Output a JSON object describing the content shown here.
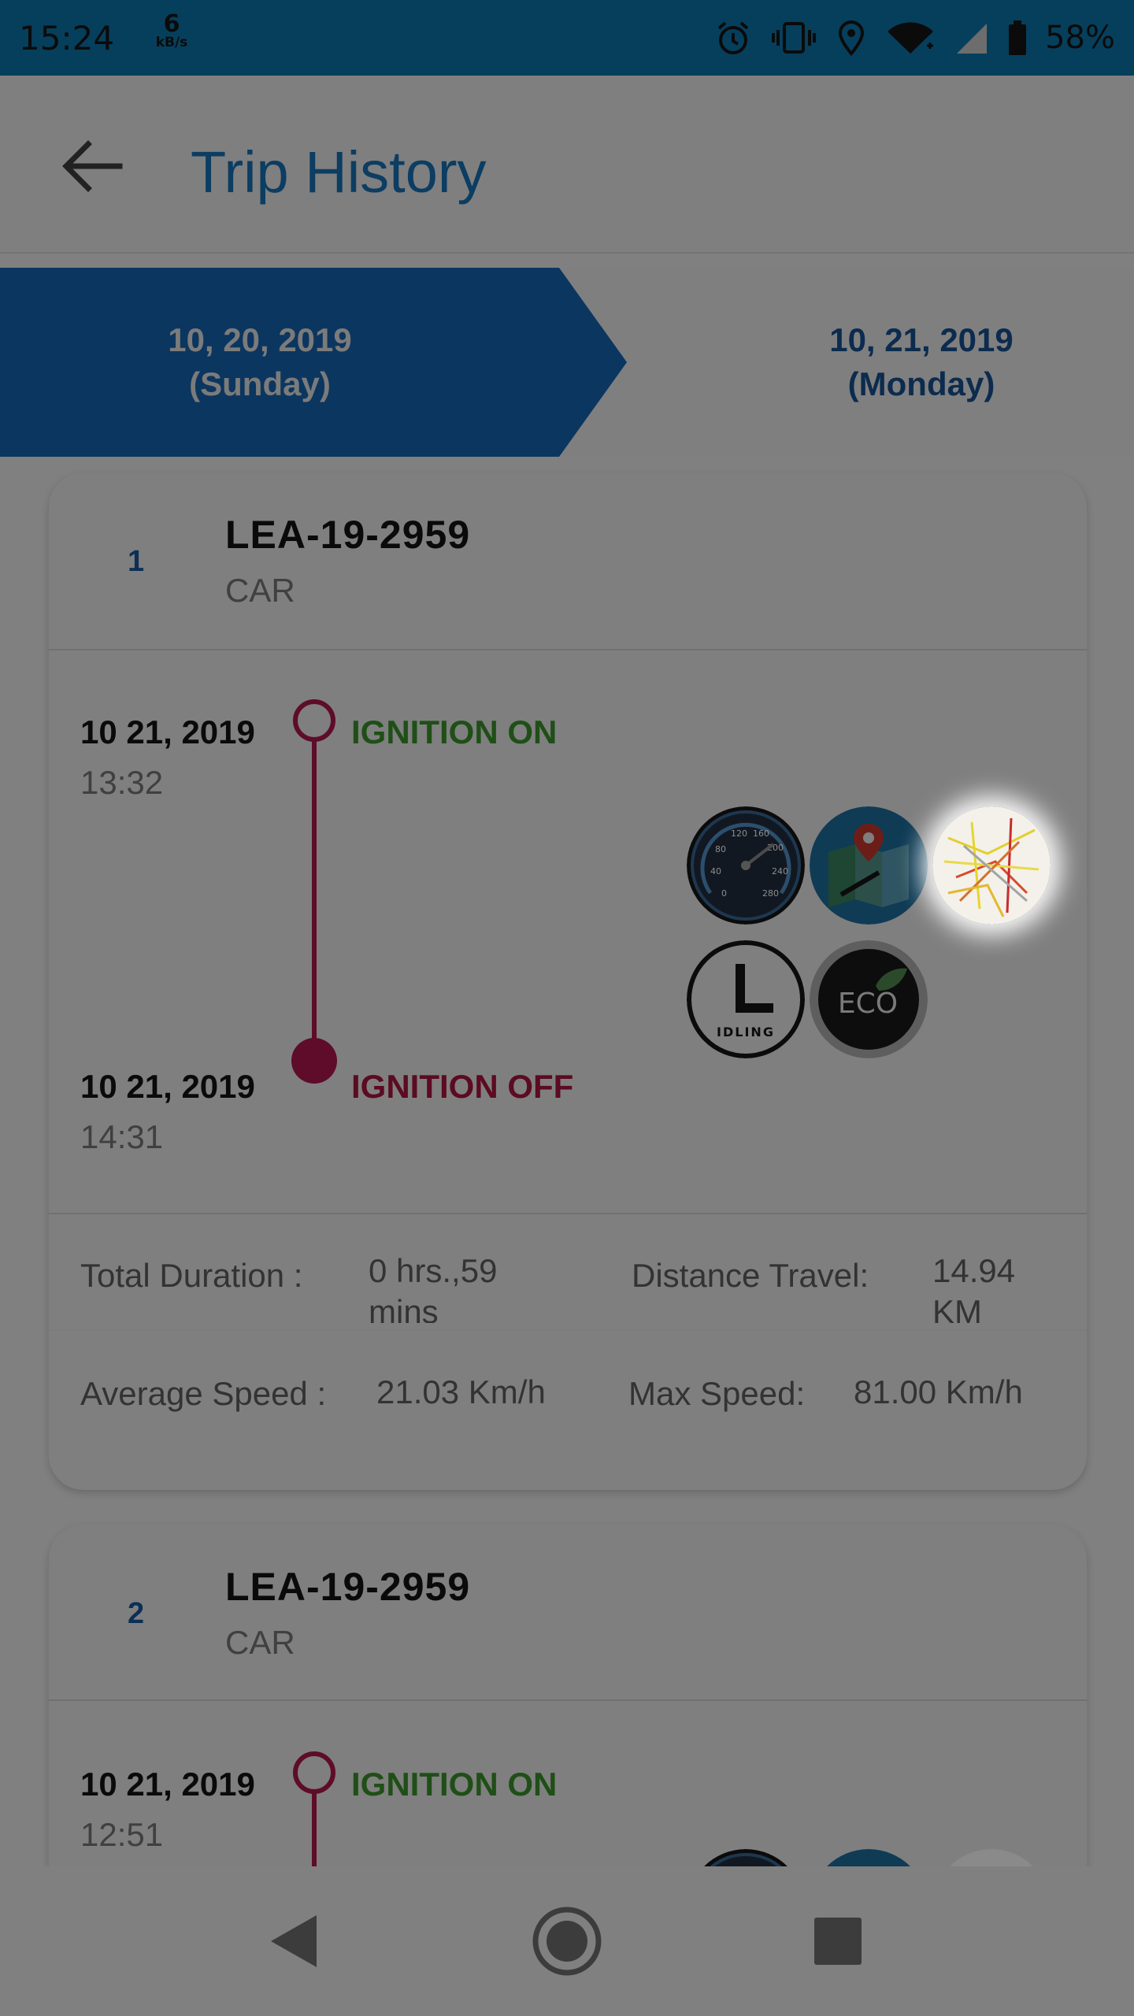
{
  "status_bar": {
    "time": "15:24",
    "net_speed": "6",
    "net_unit": "kB/s",
    "battery": "58%",
    "icons": [
      "alarm-icon",
      "vibrate-icon",
      "location-icon",
      "wifi-icon",
      "signal-icon",
      "battery-icon"
    ]
  },
  "app_bar": {
    "title": "Trip History",
    "back_icon": "arrow-left-icon"
  },
  "dates": {
    "selected": {
      "date": "10, 20, 2019",
      "day": "(Sunday)"
    },
    "next": {
      "date": "10, 21, 2019",
      "day": "(Monday)"
    }
  },
  "trips": [
    {
      "index": "1",
      "plate": "LEA-19-2959",
      "type": "CAR",
      "start": {
        "date": "10 21, 2019",
        "time": "13:32",
        "label": "IGNITION ON"
      },
      "end": {
        "date": "10 21, 2019",
        "time": "14:31",
        "label": "IGNITION OFF"
      },
      "actions": [
        "speedometer-icon",
        "map-route-icon",
        "heatmap-icon",
        "idling-icon",
        "eco-icon"
      ],
      "idling_text": "IDLING",
      "eco_text": "ECO",
      "stats": {
        "duration_label": "Total Duration :",
        "duration_value_1": "0 hrs.,59",
        "duration_value_2": "mins",
        "distance_label": "Distance Travel:",
        "distance_value_1": "14.94",
        "distance_value_2": "KM",
        "avg_speed_label": "Average Speed :",
        "avg_speed_value": "21.03 Km/h",
        "max_speed_label": "Max Speed:",
        "max_speed_value": "81.00 Km/h"
      }
    },
    {
      "index": "2",
      "plate": "LEA-19-2959",
      "type": "CAR",
      "start": {
        "date": "10 21, 2019",
        "time": "12:51",
        "label": "IGNITION ON"
      }
    }
  ],
  "nav_bar": {
    "buttons": [
      "back-icon",
      "home-icon",
      "recents-icon"
    ]
  },
  "colors": {
    "status_bar": "#063f5c",
    "selected_date": "#0b3660",
    "ignition_on": "#1f4f17",
    "ignition_off": "#5b0b22",
    "timeline": "#5e0c2a",
    "overlay_bg": "#7f7f7f"
  }
}
